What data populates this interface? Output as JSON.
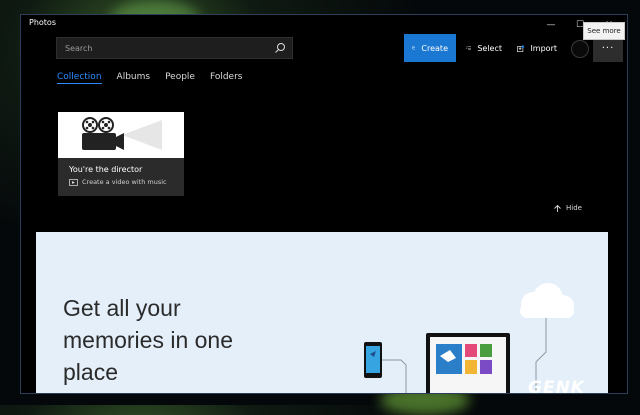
{
  "window": {
    "title": "Photos"
  },
  "titlebar": {
    "minimize_glyph": "—",
    "maximize_glyph": "☐",
    "close_glyph": "✕",
    "tooltip": "See more"
  },
  "search": {
    "placeholder": "Search",
    "value": ""
  },
  "toolbar": {
    "create_label": "Create",
    "select_label": "Select",
    "import_label": "Import",
    "more_glyph": "···"
  },
  "tabs": [
    {
      "label": "Collection",
      "active": true
    },
    {
      "label": "Albums",
      "active": false
    },
    {
      "label": "People",
      "active": false
    },
    {
      "label": "Folders",
      "active": false
    }
  ],
  "card": {
    "title": "You're the director",
    "subtitle": "Create a video with music"
  },
  "hide_label": "Hide",
  "promo": {
    "headline": "Get all your\nmemories in one\nplace"
  },
  "watermark": "GENK",
  "colors": {
    "accent": "#1a78d2",
    "tab_active": "#2b8cff",
    "promo_bg": "#e4eff9"
  },
  "icons": [
    "search-icon",
    "create-icon",
    "select-icon",
    "import-icon",
    "projector-icon",
    "video-icon",
    "arrow-up-icon",
    "cloud-icon",
    "phone-icon",
    "laptop-icon"
  ]
}
